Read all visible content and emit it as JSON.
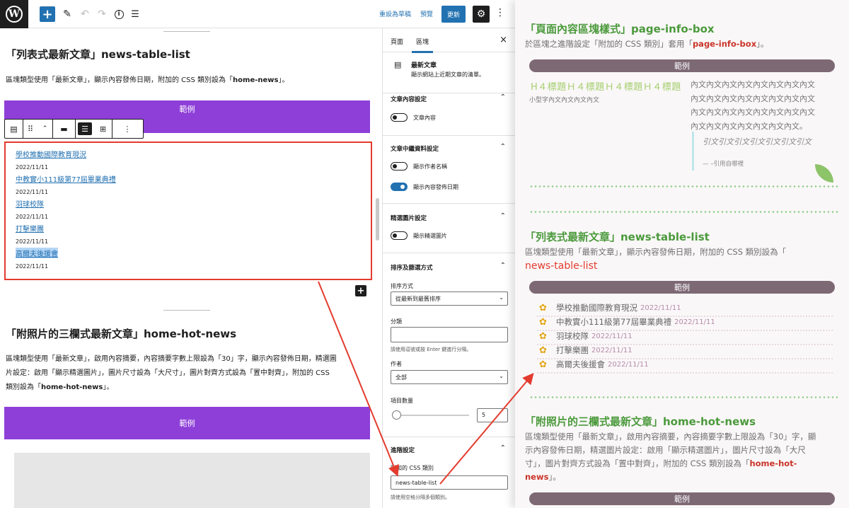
{
  "toolbar": {
    "save_draft": "重設為草稿",
    "preview": "預覽",
    "update": "更新",
    "add_symbol": "+",
    "more_symbol": "⋮"
  },
  "editor": {
    "section1": {
      "title": "「列表式最新文章」news-table-list",
      "desc_prefix": "區塊類型使用「最新文章」，顯示內容發佈日期，附加的 CSS 類別設為「",
      "desc_class": "home-news",
      "desc_suffix": "」。",
      "example_label": "範例",
      "posts": [
        {
          "title": "學校推動國際教育現況",
          "date": "2022/11/11"
        },
        {
          "title": "中教實小111級第77屆畢業典禮",
          "date": "2022/11/11"
        },
        {
          "title": "羽球校隊",
          "date": "2022/11/11"
        },
        {
          "title": "打擊樂團",
          "date": "2022/11/11"
        },
        {
          "title": "高爾夫後援會",
          "date": "2022/11/11"
        }
      ]
    },
    "section2": {
      "title": "「附照片的三欄式最新文章」home-hot-news",
      "desc_line1": "區塊類型使用「最新文章」，啟用內容摘要，內容摘要字數上限設為「30」字，顯示內容發佈日期，精選圖",
      "desc_line2": "片設定：啟用「顯示精選圖片」，圖片尺寸設為「大尺寸」，圖片對齊方式設為「置中對齊」，附加的 CSS",
      "desc_line3_prefix": "類別設為「",
      "desc_line3_class": "home-hot-news",
      "desc_line3_suffix": "」。",
      "example_label": "範例"
    }
  },
  "sidebar": {
    "tab_page": "頁面",
    "tab_block": "區塊",
    "close": "×",
    "block_name": "最新文章",
    "block_desc": "顯示網站上近期文章的清單。",
    "content_settings": {
      "title": "文章內容設定",
      "toggle_label": "文章內容",
      "enabled": false
    },
    "meta_settings": {
      "title": "文章中繼資料設定",
      "author_label": "顯示作者名稱",
      "author_enabled": false,
      "date_label": "顯示內容發佈日期",
      "date_enabled": true
    },
    "featured_settings": {
      "title": "精選圖片設定",
      "toggle_label": "顯示精選圖片",
      "enabled": false
    },
    "sorting": {
      "title": "排序及篩選方式",
      "order_label": "排序方式",
      "order_value": "從最新到最舊排序",
      "category_label": "分類",
      "category_value": "",
      "category_help": "請使用逗號或按 Enter 鍵進行分隔。",
      "author_label": "作者",
      "author_value": "全部",
      "count_label": "項目數量",
      "count_value": "5"
    },
    "advanced": {
      "title": "進階設定",
      "css_label": "附加的 CSS 類別",
      "css_value": "news-table-list",
      "css_help": "請使用空格分隔多個類別。"
    }
  },
  "preview": {
    "info_box": {
      "title": "「頁面內容區塊樣式」page-info-box",
      "desc_prefix": "於區塊之進階設定「附加的 CSS 類別」套用「",
      "desc_class": "page-info-box",
      "desc_suffix": "」。",
      "example_label": "範例",
      "h4_text": "H４標題Ｈ４標題Ｈ４標題Ｈ４標題",
      "small_text": "小型字內文內文內文內文",
      "body_lines": [
        "內文內文內文內文內文內文內文內文",
        "內文內文內文內文內文內文內文內文",
        "內文內文內文內文內文內文內文內文",
        "內文內文內文內文內文內文內文。"
      ],
      "quote_text": "引文引文引文引文引文引文引文",
      "quote_source": "— –引用自哪裡"
    },
    "news_list": {
      "title": "「列表式最新文章」news-table-list",
      "desc": "區塊類型使用「最新文章」，顯示內容發佈日期，附加的 CSS 類別設為「",
      "desc_class": "news-table-list",
      "example_label": "範例",
      "posts": [
        {
          "title": "學校推動國際教育現況",
          "date": "2022/11/11"
        },
        {
          "title": "中教實小111級第77屆畢業典禮",
          "date": "2022/11/11"
        },
        {
          "title": "羽球校隊",
          "date": "2022/11/11"
        },
        {
          "title": "打擊樂團",
          "date": "2022/11/11"
        },
        {
          "title": "高爾夫後援會",
          "date": "2022/11/11"
        }
      ]
    },
    "hot_news": {
      "title": "「附照片的三欄式最新文章」home-hot-news",
      "desc_line1": "區塊類型使用「最新文章」，啟用內容摘要，內容摘要字數上限設為「30」字，顯",
      "desc_line2": "示內容發佈日期，精選圖片設定：啟用「顯示精選圖片」，圖片尺寸設為「大尺",
      "desc_line3": "寸」，圖片對齊方式設為「置中對齊」，附加的 CSS 類別設為「",
      "desc_class_a": "home-hot-",
      "desc_class_b": "news",
      "desc_suffix": "」。",
      "example_label": "範例"
    }
  },
  "colors": {
    "accent_blue": "#2271b1",
    "example_purple": "#8e3fd8",
    "highlight_red": "#e33b2e",
    "preview_green": "#4b9a3c",
    "preview_bar": "#7d6974"
  }
}
